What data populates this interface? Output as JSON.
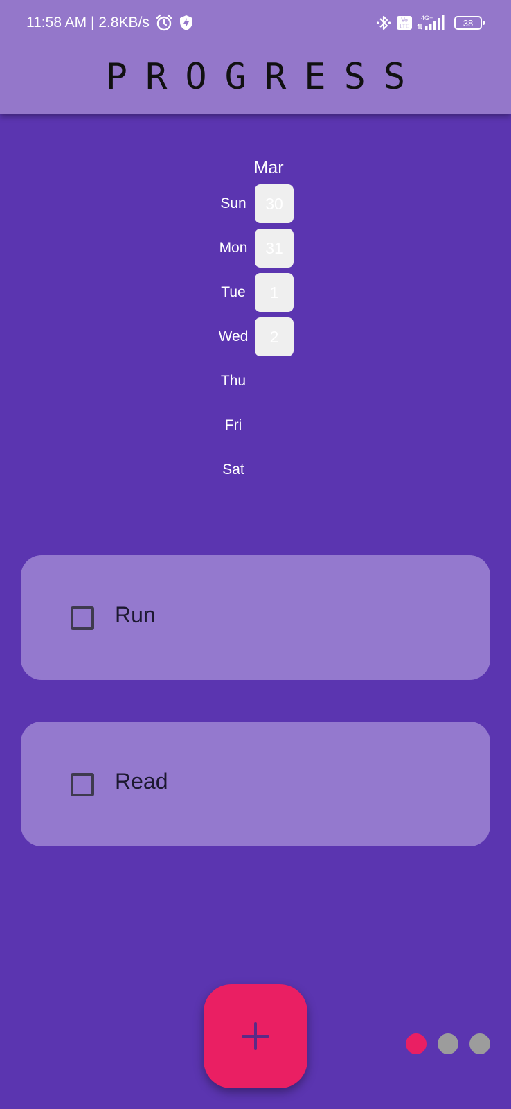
{
  "status_bar": {
    "time_speed": "11:58 AM | 2.8KB/s",
    "alarm_icon": "alarm-clock-icon",
    "shield_icon": "shield-bolt-icon",
    "bluetooth_icon": "bluetooth-icon",
    "volte_badge": "Vo LTE",
    "network_label": "4G+",
    "battery_level": "38"
  },
  "app_bar": {
    "title": "PROGRESS",
    "background_color": "#9477ca"
  },
  "calendar": {
    "month": "Mar",
    "days": [
      {
        "name": "Sun",
        "date": "30"
      },
      {
        "name": "Mon",
        "date": "31"
      },
      {
        "name": "Tue",
        "date": "1"
      },
      {
        "name": "Wed",
        "date": "2"
      },
      {
        "name": "Thu",
        "date": ""
      },
      {
        "name": "Fri",
        "date": ""
      },
      {
        "name": "Sat",
        "date": ""
      }
    ],
    "cell_color": "#efefef"
  },
  "tasks": [
    {
      "label": "Run",
      "checked": false
    },
    {
      "label": "Read",
      "checked": false
    }
  ],
  "fab": {
    "icon": "plus-icon",
    "color": "#ea1f63"
  },
  "page_indicator": {
    "total": 3,
    "active_index": 0,
    "active_color": "#ea1f63",
    "inactive_color": "#9c9c9c"
  },
  "colors": {
    "background": "#5b35b0",
    "card": "#9479ce"
  }
}
